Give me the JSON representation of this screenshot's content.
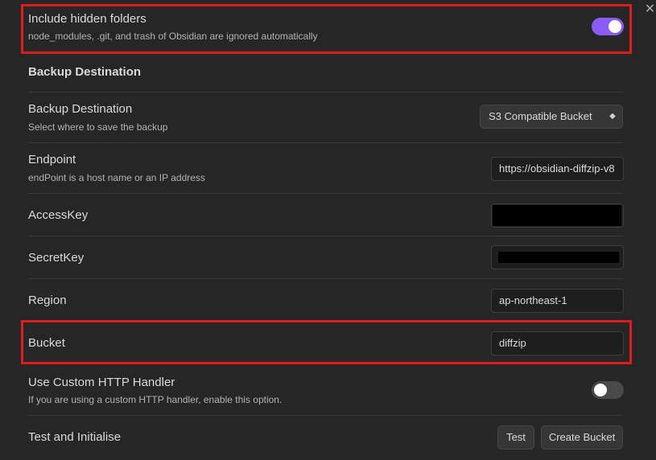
{
  "window": {
    "close_icon": "close-icon",
    "close_glyph": "✕"
  },
  "hidden_folders": {
    "name": "Include hidden folders",
    "desc": "node_modules, .git, and trash of Obsidian are ignored automatically",
    "enabled": true
  },
  "section": {
    "heading": "Backup Destination"
  },
  "destination": {
    "name": "Backup Destination",
    "desc": "Select where to save the backup",
    "selected": "S3 Compatible Bucket"
  },
  "endpoint": {
    "name": "Endpoint",
    "desc": "endPoint is a host name or an IP address",
    "value": "https://obsidian-diffzip-v8"
  },
  "access_key": {
    "name": "AccessKey"
  },
  "secret_key": {
    "name": "SecretKey"
  },
  "region": {
    "name": "Region",
    "value": "ap-northeast-1"
  },
  "bucket": {
    "name": "Bucket",
    "value": "diffzip"
  },
  "custom_http": {
    "name": "Use Custom HTTP Handler",
    "desc": "If you are using a custom HTTP handler, enable this option.",
    "enabled": false
  },
  "test_init": {
    "name": "Test and Initialise",
    "test_label": "Test",
    "create_label": "Create Bucket"
  },
  "colors": {
    "accent": "#8a5cf5",
    "highlight": "#e01b1b",
    "background": "#262626"
  }
}
